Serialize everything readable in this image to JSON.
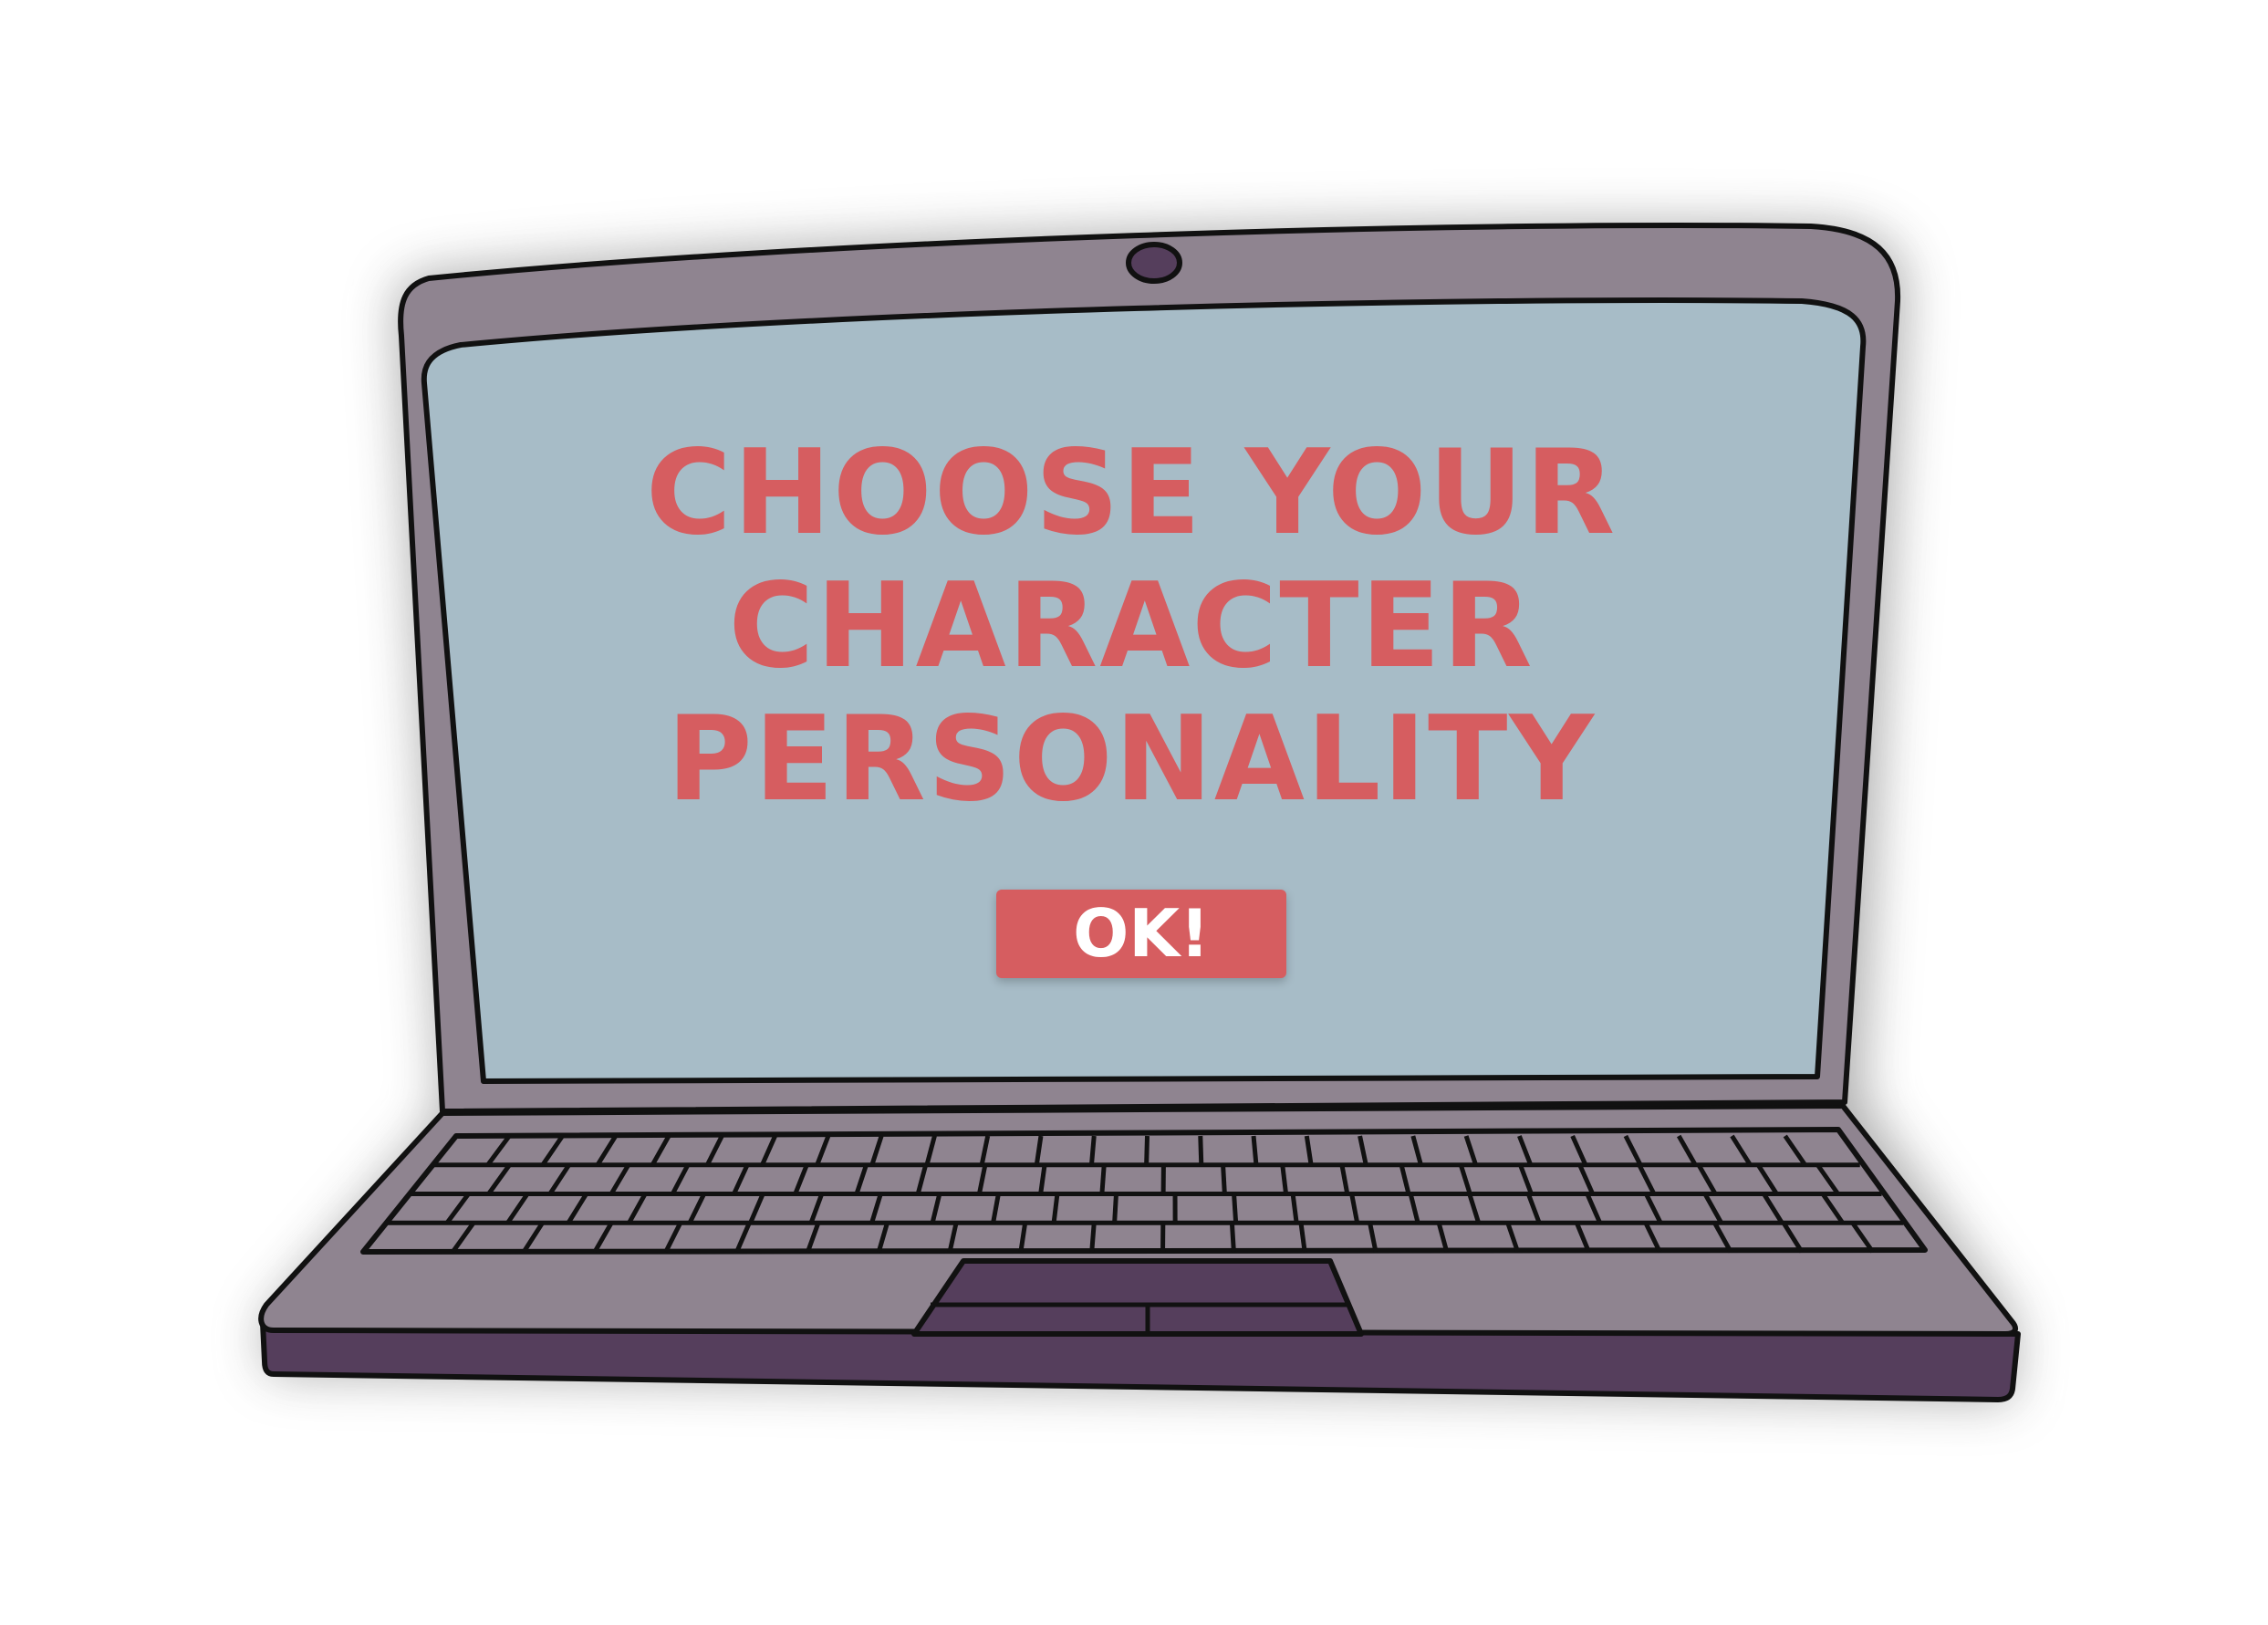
{
  "dialog": {
    "headline_lines": [
      "CHOOSE YOUR",
      "CHARACTER",
      "PERSONALITY"
    ],
    "ok_label": "OK!"
  },
  "colors": {
    "screen": "#a7bcc7",
    "laptop_body": "#8f8490",
    "laptop_edge": "#553e5c",
    "outline": "#111111",
    "accent": "#d65d60",
    "button_text": "#ffffff"
  }
}
